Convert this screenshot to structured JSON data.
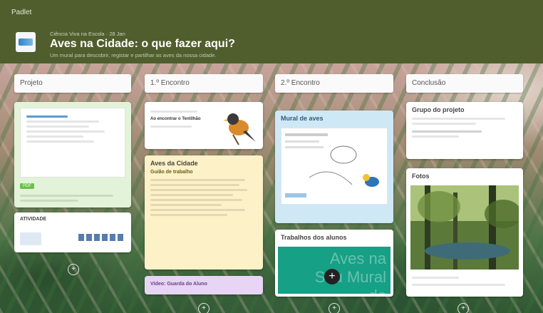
{
  "header": {
    "app_label": "Padlet",
    "meta": "Ciência Viva na Escola · 28 Jan",
    "title": "Aves na Cidade: o que fazer aqui?",
    "subtitle": "Um mural para descobrir, registar e partilhar as aves da nossa cidade."
  },
  "columns": [
    {
      "label": "Projeto"
    },
    {
      "label": "1.º Encontro"
    },
    {
      "label": "2.º Encontro"
    },
    {
      "label": "Conclusão"
    }
  ],
  "cards": {
    "projeto_doc": {
      "badge": "PDF"
    },
    "atividade": {
      "title": "ATIVIDADE"
    },
    "bird_note": {
      "text": "Ao encontrar o Tentilhão"
    },
    "aves_cidade": {
      "title": "Aves da Cidade",
      "subtitle": "Guião de trabalho"
    },
    "video_card": {
      "label": "Vídeo: Guarda do Aluno"
    },
    "mural": {
      "title": "Mural de aves"
    },
    "trabalhos": {
      "title": "Trabalhos dos alunos"
    },
    "green_banner": {
      "text": "Aves na Seu Mural do"
    },
    "grupo": {
      "title": "Grupo do projeto"
    },
    "fotos": {
      "title": "Fotos"
    }
  },
  "icons": {
    "add": "+",
    "fab": "+"
  },
  "colors": {
    "header": "#4f5e2c",
    "green_card": "#e3f3da",
    "yellow_card": "#fdf1c7",
    "purple_card": "#e8d5f5",
    "blue_card": "#cfe8f6",
    "teal_card": "#16a085"
  }
}
